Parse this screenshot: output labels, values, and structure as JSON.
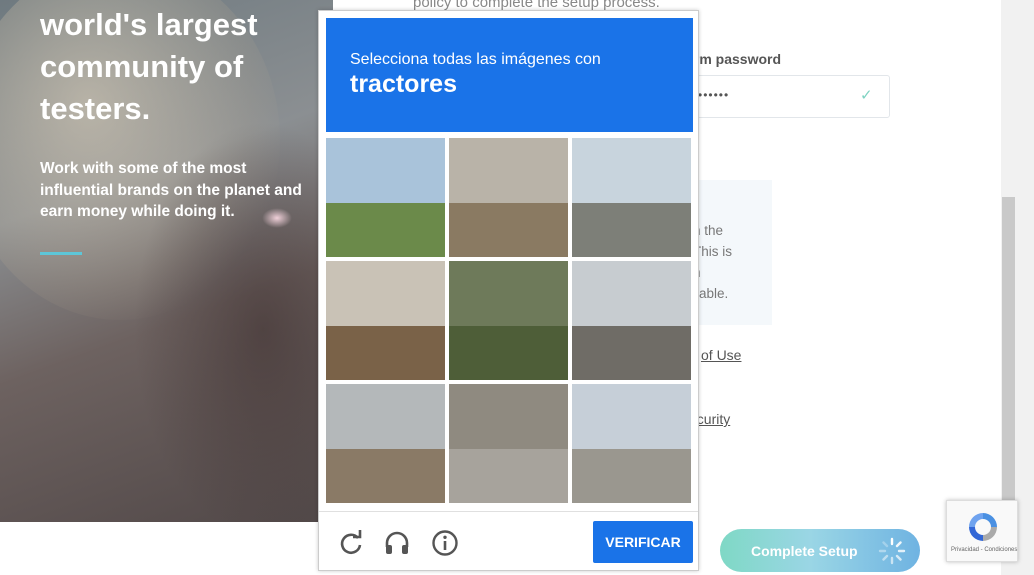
{
  "hero": {
    "title_lines": [
      "world's largest",
      "community of",
      "testers."
    ],
    "subtitle": "Work with some of the most influential brands on the planet and earn money while doing it."
  },
  "form": {
    "policy_text": "policy to complete the setup process.",
    "password_label": "irm password",
    "password_dots": "••••••",
    "info_lines": [
      "n the",
      "This is",
      "n",
      "ilable."
    ],
    "terms_link": "of Use",
    "security_link": "ecurity",
    "complete_button": "Complete Setup"
  },
  "captcha": {
    "instruction": "Selecciona todas las imágenes con",
    "object": "tractores",
    "tiles": [
      {
        "name": "tile-power-pole-road",
        "sky": "#a9c3da",
        "ground": "#6b8a4a"
      },
      {
        "name": "tile-traffic-light",
        "sky": "#b9b3a8",
        "ground": "#8a7a62"
      },
      {
        "name": "tile-highway-intersection",
        "sky": "#c8d4dd",
        "ground": "#7d7f78"
      },
      {
        "name": "tile-tractors-field",
        "sky": "#c9c2b6",
        "ground": "#7a6248"
      },
      {
        "name": "tile-green-tractor",
        "sky": "#6e7a5a",
        "ground": "#4e5e38"
      },
      {
        "name": "tile-bridge-road",
        "sky": "#c7ccd0",
        "ground": "#6f6c66"
      },
      {
        "name": "tile-tractor-road",
        "sky": "#b4b8ba",
        "ground": "#8a7a66"
      },
      {
        "name": "tile-bicycles-sidewalk",
        "sky": "#8f8a80",
        "ground": "#a7a39c"
      },
      {
        "name": "tile-palm-tree-blurry",
        "sky": "#c6cfd8",
        "ground": "#9a978f"
      }
    ],
    "verify_button": "VERIFICAR"
  },
  "badge": {
    "text": "Privacidad - Condiciones"
  },
  "colors": {
    "captcha_blue": "#1a73e8",
    "accent_line": "#5dc6d8",
    "success_check": "#7fd3c2"
  }
}
